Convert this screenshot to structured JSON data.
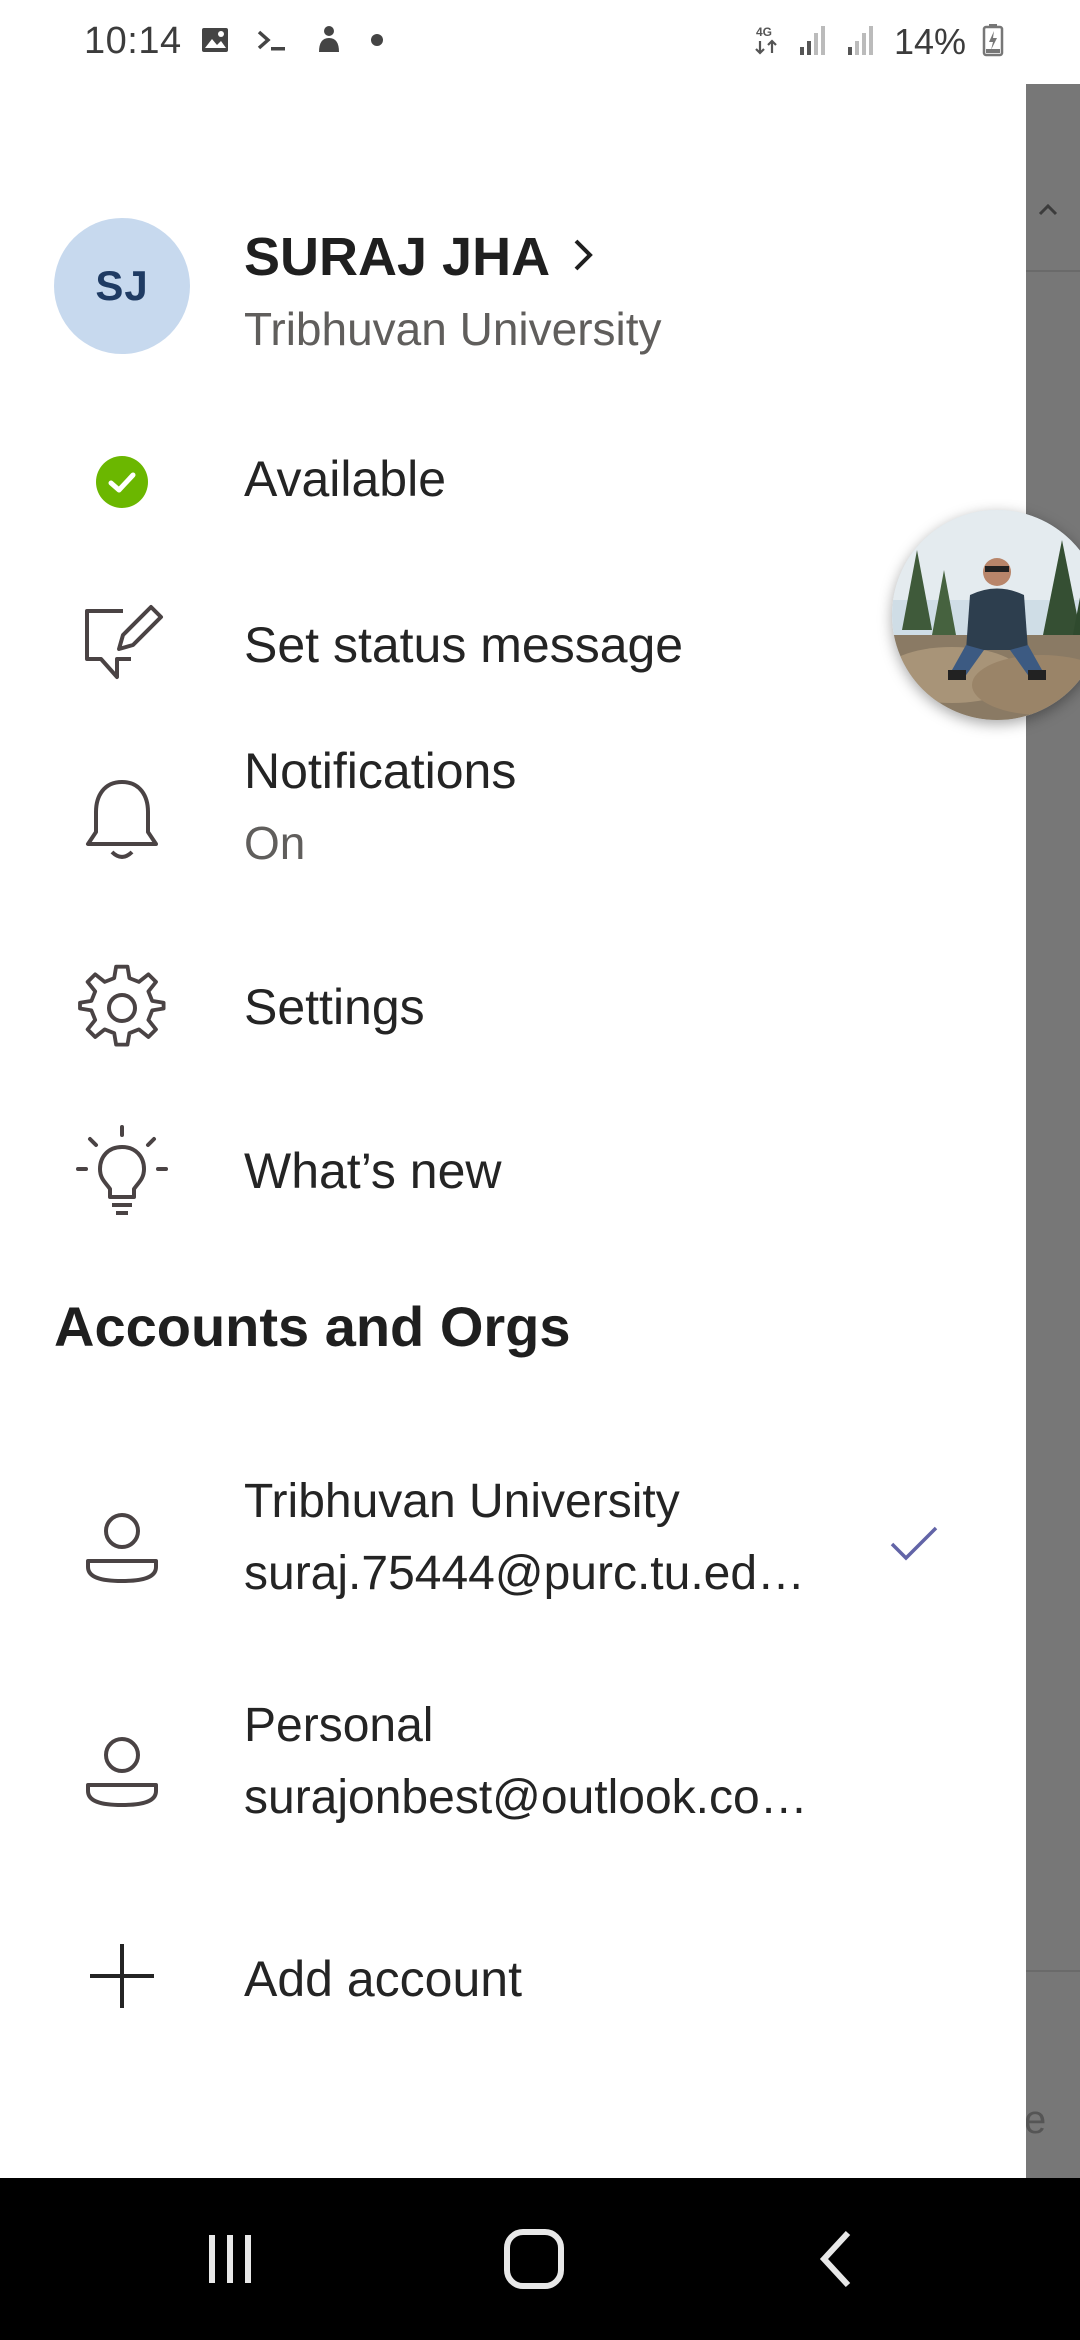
{
  "status_bar": {
    "time": "10:14",
    "battery_percent": "14%",
    "network": "4G"
  },
  "profile": {
    "initials": "SJ",
    "name": "SURAJ JHA",
    "org": "Tribhuvan University"
  },
  "menu": {
    "available": "Available",
    "set_status": "Set status message",
    "notifications": "Notifications",
    "notifications_state": "On",
    "settings": "Settings",
    "whats_new": "What’s new"
  },
  "accounts": {
    "section_title": "Accounts and Orgs",
    "items": [
      {
        "title": "Tribhuvan University",
        "email": "suraj.75444@purc.tu.ed…",
        "selected": true
      },
      {
        "title": "Personal",
        "email": "surajonbest@outlook.co…",
        "selected": false
      }
    ],
    "add_label": "Add account"
  },
  "background_app": {
    "partial_letter": "e"
  },
  "colors": {
    "available_green": "#6bb700",
    "check_purple": "#6264a7",
    "avatar_bg": "#c7d9ee",
    "scrim": "#777777"
  }
}
